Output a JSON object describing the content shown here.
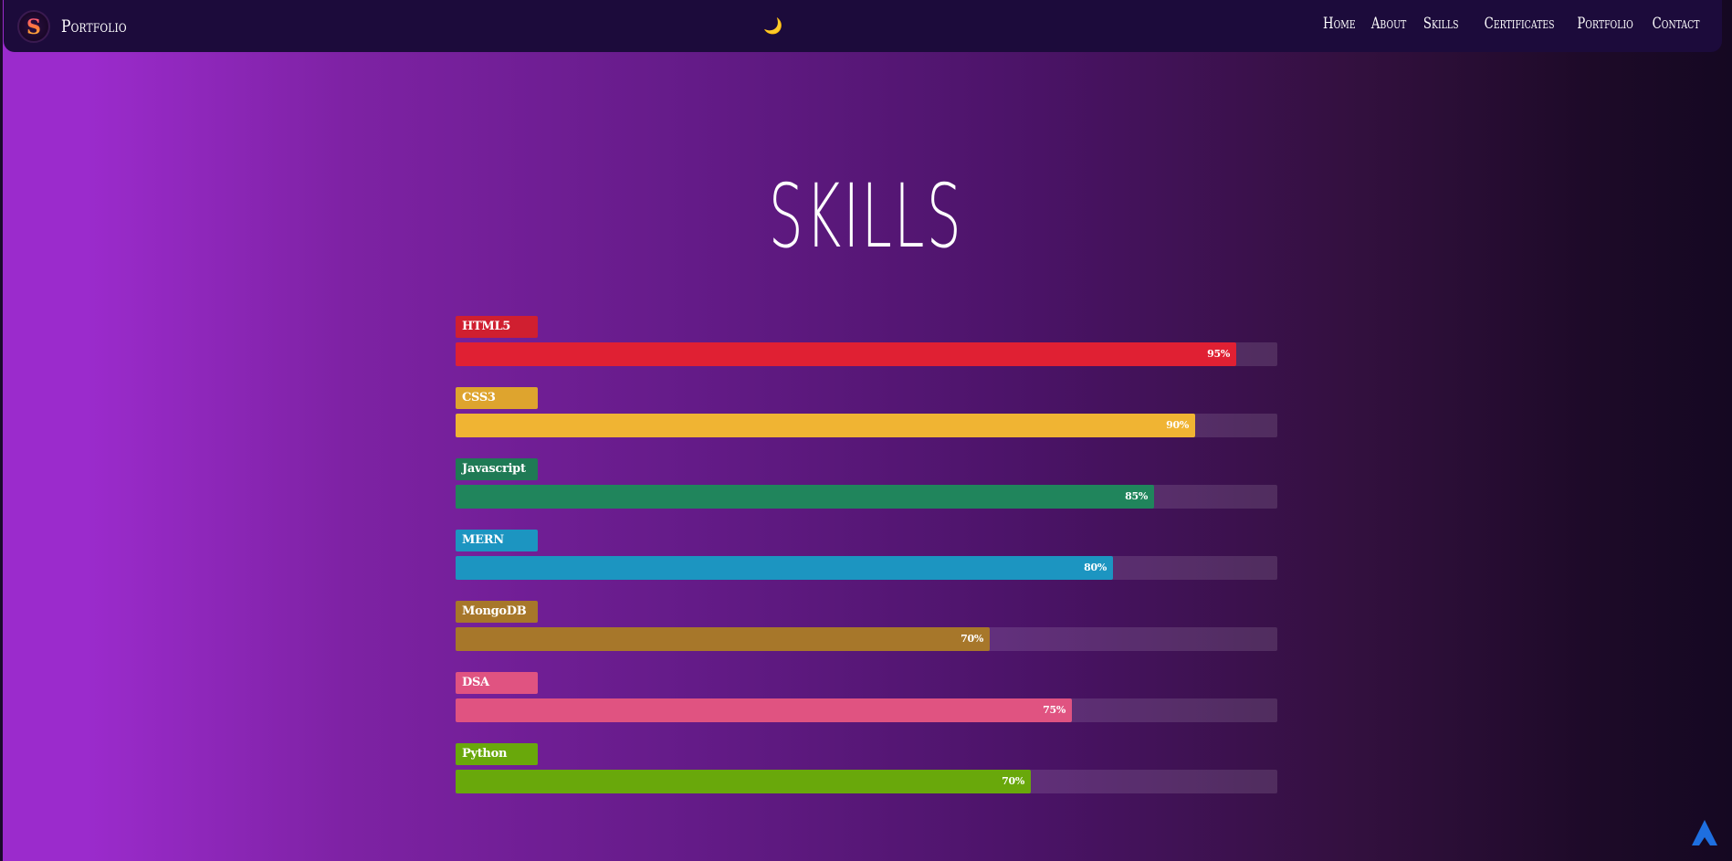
{
  "navbar": {
    "brand": "Portfolio",
    "logo_letter": "S",
    "theme_toggle_icon": "🌙",
    "links": [
      "Home",
      "About",
      "Skills",
      "Certificates",
      "Portfolio",
      "Contact"
    ]
  },
  "page": {
    "title": "SKILLS"
  },
  "skills": [
    {
      "name": "HTML5",
      "percent": 95,
      "percent_label": "95%",
      "color": "#e02033",
      "label_color": "#d01f30"
    },
    {
      "name": "CSS3",
      "percent": 90,
      "percent_label": "90%",
      "color": "#f0b433",
      "label_color": "#dea42e"
    },
    {
      "name": "Javascript",
      "percent": 85,
      "percent_label": "85%",
      "color": "#20855c",
      "label_color": "#1f7a55"
    },
    {
      "name": "MERN",
      "percent": 80,
      "percent_label": "80%",
      "color": "#1c95c1",
      "label_color": "#1c95c1"
    },
    {
      "name": "MongoDB",
      "percent": 65,
      "percent_label": "70%",
      "color": "#a7772a",
      "label_color": "#a7772a"
    },
    {
      "name": "DSA",
      "percent": 75,
      "percent_label": "75%",
      "color": "#e05381",
      "label_color": "#e05381"
    },
    {
      "name": "Python",
      "percent": 70,
      "percent_label": "70%",
      "color": "#69a80b",
      "label_color": "#69a80b"
    }
  ],
  "scroll_top": {
    "icon": "arrow-up-icon",
    "color": "#1e6fe0"
  }
}
